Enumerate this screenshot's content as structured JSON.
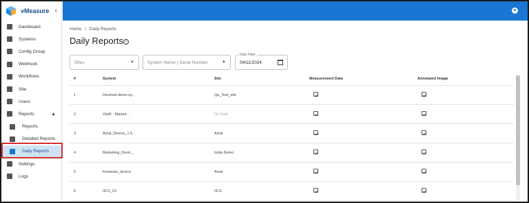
{
  "brand": {
    "name": "vMeasure",
    "collapse_icon": "chevron-left-icon"
  },
  "sidebar": {
    "items": [
      {
        "label": "Dashboard",
        "icon": "dashboard-icon"
      },
      {
        "label": "Systems",
        "icon": "monitor-icon"
      },
      {
        "label": "Config Group",
        "icon": "config-gear-icon"
      },
      {
        "label": "Webhook",
        "icon": "webhook-icon"
      },
      {
        "label": "Workflows",
        "icon": "workflow-icon"
      },
      {
        "label": "Site",
        "icon": "location-pin-icon"
      },
      {
        "label": "Users",
        "icon": "users-icon"
      },
      {
        "label": "Reports",
        "icon": "reports-icon",
        "expanded": true
      },
      {
        "label": "Reports",
        "icon": "report-icon",
        "sub": true
      },
      {
        "label": "Detailed Reports",
        "icon": "detailed-report-icon",
        "sub": true
      },
      {
        "label": "Daily Reports",
        "icon": "daily-report-icon",
        "sub": true,
        "active": true
      },
      {
        "label": "Settings",
        "icon": "settings-gear-icon"
      },
      {
        "label": "Logs",
        "icon": "logs-icon"
      }
    ]
  },
  "breadcrumb": {
    "home": "Home",
    "separator": "/",
    "current": "Daily Reports"
  },
  "page": {
    "title": "Daily Reports"
  },
  "filters": {
    "sites_placeholder": "Sites",
    "system_placeholder": "System Name | Serial Number",
    "date_label": "Date Filter",
    "date_value": "04/11/2024"
  },
  "table": {
    "headers": [
      "#",
      "System",
      "Site",
      "Measurement Data",
      "Annotated Image"
    ],
    "rows": [
      {
        "num": "1",
        "system": "Decimal-demo-sy...",
        "site": "Qa_Test_site",
        "site_nodata": false
      },
      {
        "num": "2",
        "system": "VisAI - Market...",
        "site": "No Data",
        "site_nodata": true
      },
      {
        "num": "3",
        "system": "Amal_Device_1 5...",
        "site": "Amal",
        "site_nodata": false
      },
      {
        "num": "4",
        "system": "Marketing_Devic...",
        "site": "India Demo",
        "site_nodata": false
      },
      {
        "num": "5",
        "system": "Kumaran_device",
        "site": "Amal",
        "site_nodata": false
      },
      {
        "num": "6",
        "system": "IICS_23",
        "site": "IICS",
        "site_nodata": false
      }
    ]
  },
  "colors": {
    "topbar": "#1976d2",
    "active_bg": "#cfe3f5",
    "highlight": "#d32f2f"
  }
}
